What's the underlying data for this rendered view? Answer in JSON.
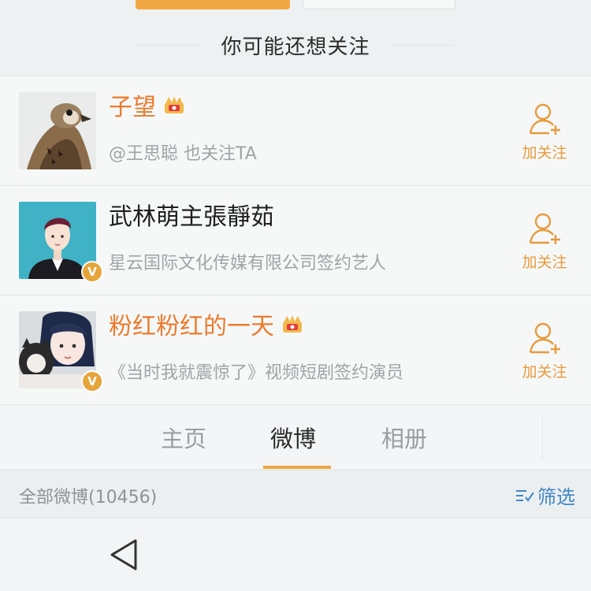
{
  "suggest": {
    "title": "你可能还想关注"
  },
  "users": [
    {
      "name": "子望",
      "name_color": "orange",
      "crown": true,
      "verified": false,
      "desc": "@王思聪 也关注TA",
      "follow_label": "加关注",
      "avatar": "falcon-avatar"
    },
    {
      "name": "武林萌主張靜茹",
      "name_color": "dark",
      "crown": false,
      "verified": true,
      "desc": "星云国际文化传媒有限公司签约艺人",
      "follow_label": "加关注",
      "avatar": "illustrated-person-avatar"
    },
    {
      "name": "粉红粉红的一天",
      "name_color": "orange",
      "crown": true,
      "verified": true,
      "desc": "《当时我就震惊了》视频短剧签约演员",
      "follow_label": "加关注",
      "avatar": "girl-with-cat-avatar"
    }
  ],
  "badge_letter": "V",
  "tabs": [
    {
      "label": "主页",
      "active": false
    },
    {
      "label": "微博",
      "active": true
    },
    {
      "label": "相册",
      "active": false
    }
  ],
  "posts": {
    "count_label": "全部微博(10456)",
    "filter_label": "筛选"
  },
  "colors": {
    "accent_orange": "#f0a641",
    "name_orange": "#ec7a2c",
    "link_blue": "#3f87c8",
    "verified_gold": "#e6a53a"
  },
  "icons": [
    "crown-icon",
    "add-user-icon",
    "verified-badge-icon",
    "filter-icon",
    "back-triangle-icon"
  ]
}
